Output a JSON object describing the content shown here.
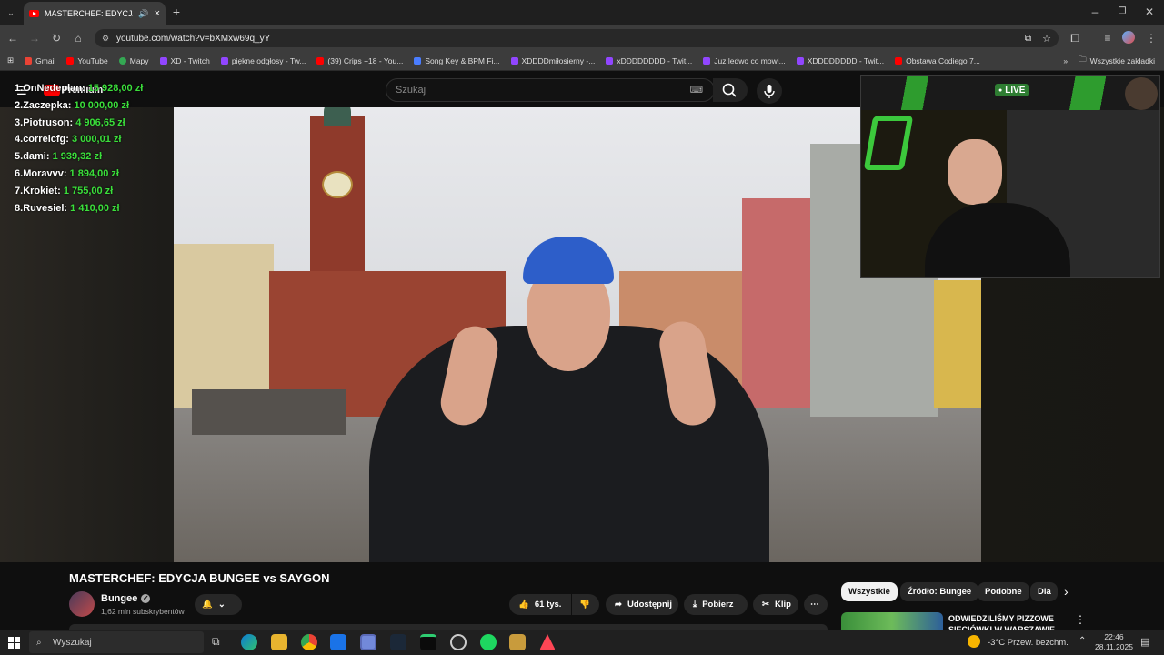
{
  "browser": {
    "tab_title": "MASTERCHEF: EDYCJA BUN",
    "url": "youtube.com/watch?v=bXMxw69q_yY",
    "bookmarks": [
      {
        "label": "Gmail",
        "color": "#ea4335"
      },
      {
        "label": "YouTube",
        "color": "#ff0000"
      },
      {
        "label": "Mapy",
        "color": "#34a853"
      },
      {
        "label": "XD - Twitch",
        "color": "#9146ff"
      },
      {
        "label": "piękne odgłosy - Tw...",
        "color": "#9146ff"
      },
      {
        "label": "(39) Crips +18 - You...",
        "color": "#ff0000"
      },
      {
        "label": "Song Key & BPM Fi...",
        "color": "#4a7dff"
      },
      {
        "label": "XDDDDmiłosierny -...",
        "color": "#9146ff"
      },
      {
        "label": "xDDDDDDDD - Twit...",
        "color": "#9146ff"
      },
      {
        "label": "Juz ledwo co mowi...",
        "color": "#9146ff"
      },
      {
        "label": "XDDDDDDDD - Twit...",
        "color": "#9146ff"
      },
      {
        "label": "Obstawa Codiego 7...",
        "color": "#ff0000"
      }
    ],
    "all_bookmarks": "Wszystkie zakładki"
  },
  "youtube": {
    "logo_text": "Premium",
    "search_placeholder": "Szukaj",
    "video_title": "MASTERCHEF: EDYCJA BUNGEE vs SAYGON",
    "channel_name": "Bungee",
    "subscribers": "1,62 mln subskrybentów",
    "likes": "61 tys.",
    "share_label": "Udostępnij",
    "download_label": "Pobierz",
    "clip_label": "Klip",
    "chips": [
      "Wszystkie",
      "Źródło: Bungee",
      "Podobne",
      "Dla"
    ],
    "next_video_title": "ODWIEDZILIŚMY PIZZOWE SIECIÓWKI W WARSZAWIE"
  },
  "overlay": {
    "leaderboard": [
      {
        "rank": "1.",
        "name": "OnNedeplan:",
        "amount": "15 928,00 zł"
      },
      {
        "rank": "2.",
        "name": "Zaczepka:",
        "amount": "10 000,00 zł"
      },
      {
        "rank": "3.",
        "name": "Piotruson:",
        "amount": "4 906,65 zł"
      },
      {
        "rank": "4.",
        "name": "correlcfg:",
        "amount": "3 000,01 zł"
      },
      {
        "rank": "5.",
        "name": "dami:",
        "amount": "1 939,32 zł"
      },
      {
        "rank": "6.",
        "name": "Moravvv:",
        "amount": "1 894,00 zł"
      },
      {
        "rank": "7.",
        "name": "Krokiet:",
        "amount": "1 755,00 zł"
      },
      {
        "rank": "8.",
        "name": "Ruvesiel:",
        "amount": "1 410,00 zł"
      }
    ],
    "live_label": "LIVE"
  },
  "taskbar": {
    "search_placeholder": "Wyszukaj",
    "weather": "-3°C  Przew. bezchm.",
    "time": "22:46",
    "date": "28.11.2025"
  }
}
